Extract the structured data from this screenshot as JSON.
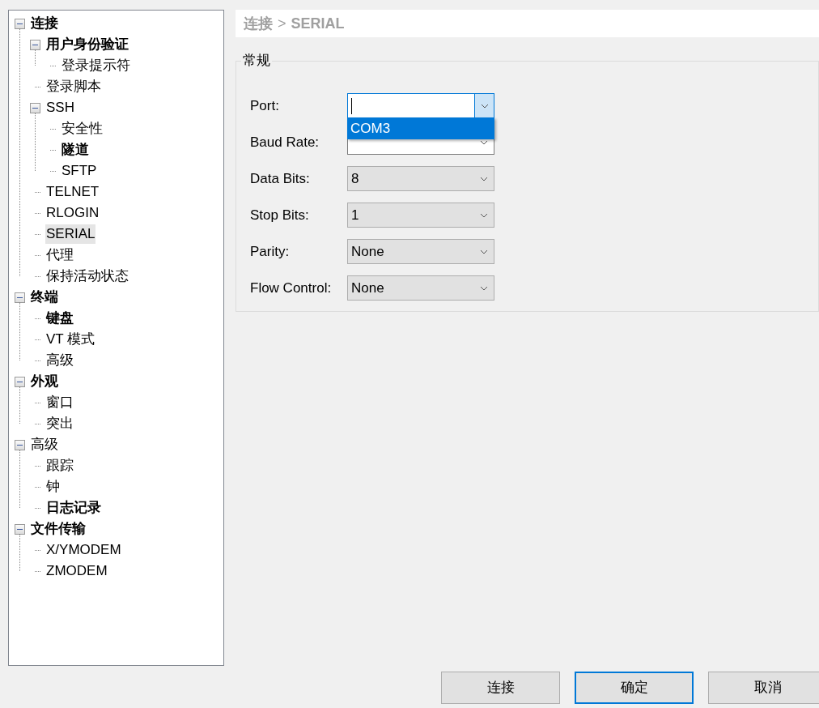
{
  "tree": [
    {
      "label": "连接",
      "bold": true,
      "expanded": true,
      "selected": false,
      "children": [
        {
          "label": "用户身份验证",
          "bold": true,
          "expanded": true,
          "selected": false,
          "children": [
            {
              "label": "登录提示符",
              "bold": false,
              "selected": false
            }
          ]
        },
        {
          "label": "登录脚本",
          "bold": false,
          "selected": false
        },
        {
          "label": "SSH",
          "bold": false,
          "expanded": true,
          "selected": false,
          "children": [
            {
              "label": "安全性",
              "bold": false,
              "selected": false
            },
            {
              "label": "隧道",
              "bold": true,
              "selected": false
            },
            {
              "label": "SFTP",
              "bold": false,
              "selected": false
            }
          ]
        },
        {
          "label": "TELNET",
          "bold": false,
          "selected": false
        },
        {
          "label": "RLOGIN",
          "bold": false,
          "selected": false
        },
        {
          "label": "SERIAL",
          "bold": false,
          "selected": true
        },
        {
          "label": "代理",
          "bold": false,
          "selected": false
        },
        {
          "label": "保持活动状态",
          "bold": false,
          "selected": false
        }
      ]
    },
    {
      "label": "终端",
      "bold": true,
      "expanded": true,
      "selected": false,
      "children": [
        {
          "label": "键盘",
          "bold": true,
          "selected": false
        },
        {
          "label": "VT 模式",
          "bold": false,
          "selected": false
        },
        {
          "label": "高级",
          "bold": false,
          "selected": false
        }
      ]
    },
    {
      "label": "外观",
      "bold": true,
      "expanded": true,
      "selected": false,
      "children": [
        {
          "label": "窗口",
          "bold": false,
          "selected": false
        },
        {
          "label": "突出",
          "bold": false,
          "selected": false
        }
      ]
    },
    {
      "label": "高级",
      "bold": false,
      "expanded": true,
      "selected": false,
      "children": [
        {
          "label": "跟踪",
          "bold": false,
          "selected": false
        },
        {
          "label": "钟",
          "bold": false,
          "selected": false
        },
        {
          "label": "日志记录",
          "bold": true,
          "selected": false
        }
      ]
    },
    {
      "label": "文件传输",
      "bold": true,
      "expanded": true,
      "selected": false,
      "children": [
        {
          "label": "X/YMODEM",
          "bold": false,
          "selected": false
        },
        {
          "label": "ZMODEM",
          "bold": false,
          "selected": false
        }
      ]
    }
  ],
  "breadcrumb": {
    "parent": "连接",
    "separator": ">",
    "current": "SERIAL"
  },
  "group": {
    "title": "常规",
    "fields": [
      {
        "label": "Port:",
        "kind": "editable",
        "focused": true,
        "expanded": true,
        "options": [
          {
            "label": "COM3",
            "selected": true
          }
        ]
      },
      {
        "label": "Baud Rate:",
        "kind": "editable",
        "focused": false,
        "expanded": false
      },
      {
        "label": "Data Bits:",
        "kind": "list",
        "focused": false,
        "expanded": false,
        "value": "8"
      },
      {
        "label": "Stop Bits:",
        "kind": "list",
        "focused": false,
        "expanded": false,
        "value": "1"
      },
      {
        "label": "Parity:",
        "kind": "list",
        "focused": false,
        "expanded": false,
        "value": "None"
      },
      {
        "label": "Flow Control:",
        "kind": "list",
        "focused": false,
        "expanded": false,
        "value": "None"
      }
    ]
  },
  "buttons": [
    {
      "label": "连接",
      "focused": false
    },
    {
      "label": "确定",
      "focused": true
    },
    {
      "label": "取消",
      "focused": false
    }
  ]
}
